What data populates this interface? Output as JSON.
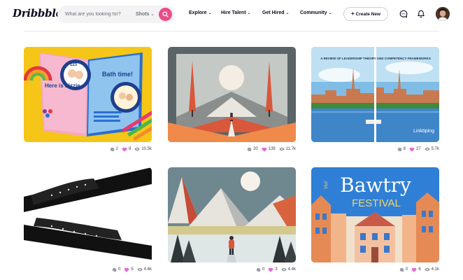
{
  "header": {
    "logo": "Dribbble",
    "search_placeholder": "What are you looking for?",
    "search_scope": "Shots",
    "nav": [
      "Explore",
      "Hire Talent",
      "Get Hired",
      "Community"
    ],
    "create_label": "Create New"
  },
  "colors": {
    "brand_pink": "#ea4c89",
    "text": "#0d0c22",
    "muted": "#6e6d7a"
  },
  "shots": [
    {
      "comments": "2",
      "likes": "8",
      "views": "10.5k",
      "art": {
        "title": "Bath time!",
        "text": "Here is Lizzie",
        "numbers": "123"
      }
    },
    {
      "comments": "20",
      "likes": "139",
      "views": "11.7k"
    },
    {
      "comments": "8",
      "likes": "27",
      "views": "5.7k",
      "art": {
        "title": "A REVIEW OF LEADERSHIP THEORY AND COMPETENCY FRAMEWORKS",
        "place": "Linköping"
      }
    },
    {
      "comments": "0",
      "likes": "5",
      "views": "4.6k"
    },
    {
      "comments": "0",
      "likes": "3",
      "views": "4.4k"
    },
    {
      "comments": "0",
      "likes": "6",
      "views": "4.1k",
      "art": {
        "title": "Bawtry",
        "subtitle": "FESTIVAL",
        "label": "Visit"
      }
    }
  ]
}
